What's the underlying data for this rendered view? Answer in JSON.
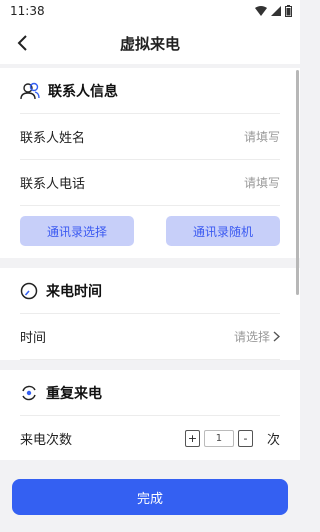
{
  "status_bar": {
    "time": "11:38"
  },
  "nav": {
    "title": "虚拟来电"
  },
  "contact_section": {
    "title": "联系人信息",
    "name_label": "联系人姓名",
    "name_placeholder": "请填写",
    "phone_label": "联系人电话",
    "phone_placeholder": "请填写",
    "contacts_pick_button": "通讯录选择",
    "contacts_random_button": "通讯录随机"
  },
  "time_section": {
    "title": "来电时间",
    "time_label": "时间",
    "time_value": "请选择"
  },
  "repeat_section": {
    "title": "重复来电",
    "count_label": "来电次数",
    "plus": "+",
    "count_value": "1",
    "minus": "-",
    "unit": "次"
  },
  "footer": {
    "done_label": "完成"
  },
  "colors": {
    "accent": "#3460f2",
    "light_button": "#c7cff9"
  }
}
